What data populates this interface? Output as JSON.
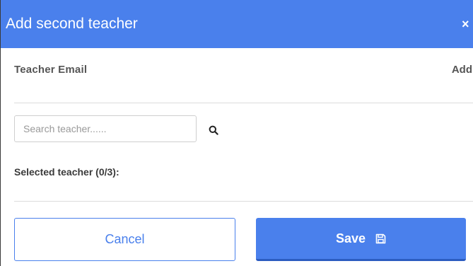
{
  "dialog": {
    "title": "Add second teacher",
    "close_glyph": "×"
  },
  "email_section": {
    "label": "Teacher Email",
    "add_label": "Add"
  },
  "search": {
    "placeholder": "Search teacher......",
    "value": "",
    "icon": "search-icon"
  },
  "selected": {
    "label": "Selected teacher (0/3):"
  },
  "buttons": {
    "cancel_label": "Cancel",
    "save_label": "Save",
    "save_icon": "floppy-disk-icon"
  },
  "colors": {
    "accent": "#4a80ec",
    "accent_dark": "#2c5cc0",
    "label_gray": "#555555"
  }
}
